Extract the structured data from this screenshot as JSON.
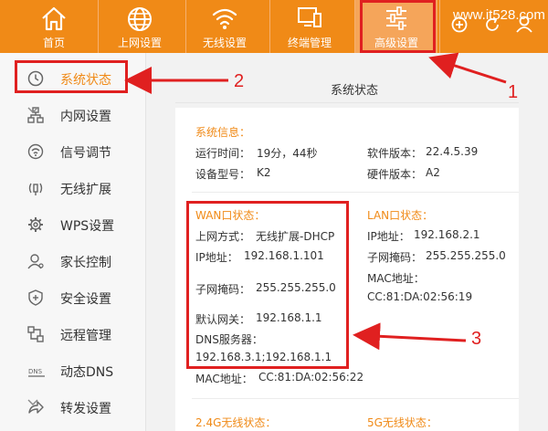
{
  "topnav": {
    "items": [
      {
        "label": "首页",
        "icon": "home-icon"
      },
      {
        "label": "上网设置",
        "icon": "globe-icon"
      },
      {
        "label": "无线设置",
        "icon": "wifi-icon"
      },
      {
        "label": "终端管理",
        "icon": "monitor-icon"
      },
      {
        "label": "高级设置",
        "icon": "sliders-icon",
        "active": true
      }
    ],
    "watermark": "www.it528.com"
  },
  "sidebar": {
    "items": [
      {
        "label": "系统状态",
        "icon": "clock-icon",
        "active": true
      },
      {
        "label": "内网设置",
        "icon": "network-icon",
        "expandable": true
      },
      {
        "label": "信号调节",
        "icon": "signal-icon"
      },
      {
        "label": "无线扩展",
        "icon": "antenna-icon"
      },
      {
        "label": "WPS设置",
        "icon": "wps-gear-icon"
      },
      {
        "label": "家长控制",
        "icon": "user-icon"
      },
      {
        "label": "安全设置",
        "icon": "shield-icon"
      },
      {
        "label": "远程管理",
        "icon": "remote-icon"
      },
      {
        "label": "动态DNS",
        "icon": "dns-icon"
      },
      {
        "label": "转发设置",
        "icon": "forward-icon",
        "expandable": true
      }
    ]
  },
  "main": {
    "title": "系统状态",
    "system_info": {
      "title": "系统信息：",
      "uptime_label": "运行时间：",
      "uptime_value": "19分，44秒",
      "model_label": "设备型号：",
      "model_value": "K2",
      "sw_label": "软件版本：",
      "sw_value": "22.4.5.39",
      "hw_label": "硬件版本：",
      "hw_value": "A2"
    },
    "wan": {
      "title": "WAN口状态：",
      "mode_label": "上网方式：",
      "mode_value": "无线扩展-DHCP",
      "ip_label": "IP地址：",
      "ip_value": "192.168.1.101",
      "mask_label": "子网掩码：",
      "mask_value": "255.255.255.0",
      "gw_label": "默认网关：",
      "gw_value": "192.168.1.1",
      "dns_label": "DNS服务器：",
      "dns_value": "192.168.3.1;192.168.1.1",
      "mac_label": "MAC地址：",
      "mac_value": "CC:81:DA:02:56:22"
    },
    "lan": {
      "title": "LAN口状态：",
      "ip_label": "IP地址：",
      "ip_value": "192.168.2.1",
      "mask_label": "子网掩码：",
      "mask_value": "255.255.255.0",
      "mac_label": "MAC地址：",
      "mac_value": "CC:81:DA:02:56:19"
    },
    "wifi24_title": "2.4G无线状态：",
    "wifi5_title": "5G无线状态："
  },
  "annotations": {
    "n1": "1",
    "n2": "2",
    "n3": "3",
    "color": "#e02020"
  },
  "colors": {
    "accent": "#f08a17"
  }
}
